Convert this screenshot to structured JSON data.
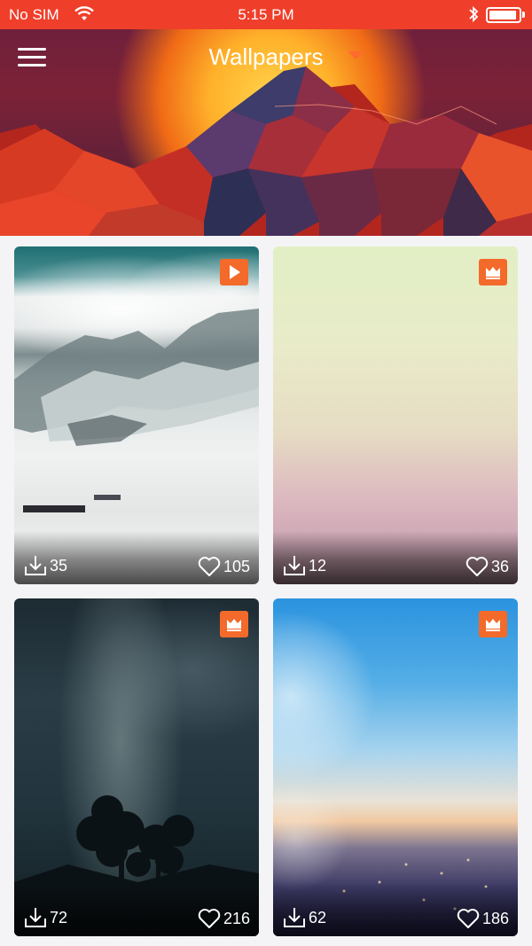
{
  "status_bar": {
    "carrier": "No SIM",
    "time": "5:15 PM"
  },
  "header": {
    "title": "Wallpapers",
    "menu_icon": "hamburger-menu-icon",
    "dropdown_icon": "chevron-down-icon"
  },
  "colors": {
    "accent": "#f36a2b",
    "status_bar": "#ef3f2a"
  },
  "wallpapers": [
    {
      "badge_icon": "play-icon",
      "downloads": "35",
      "likes": "105"
    },
    {
      "badge_icon": "crown-icon",
      "downloads": "12",
      "likes": "36"
    },
    {
      "badge_icon": "crown-icon",
      "downloads": "72",
      "likes": "216"
    },
    {
      "badge_icon": "crown-icon",
      "downloads": "62",
      "likes": "186"
    }
  ]
}
